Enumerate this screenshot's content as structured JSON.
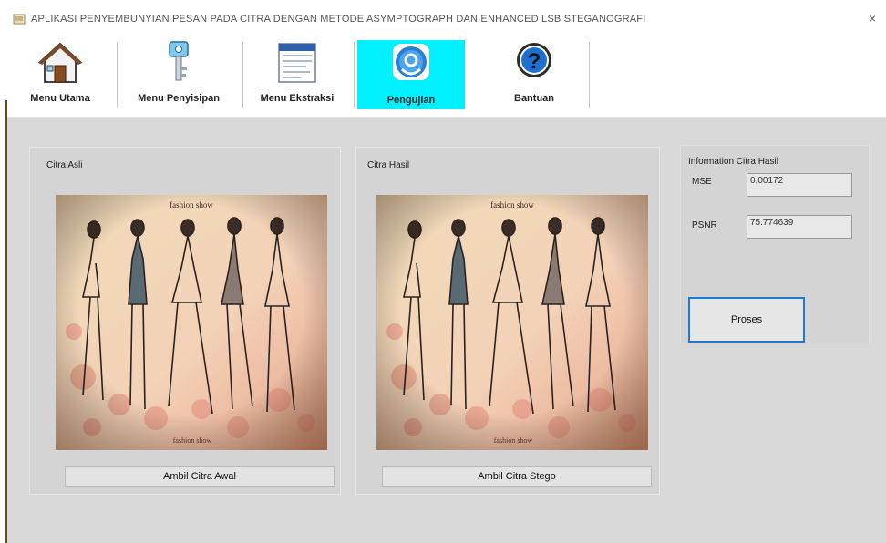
{
  "window": {
    "title": "APLIKASI PENYEMBUNYIAN PESAN PADA CITRA DENGAN METODE ASYMPTOGRAPH DAN ENHANCED LSB STEGANOGRAFI",
    "close_glyph": "×"
  },
  "toolbar": {
    "items": [
      {
        "label": "Menu Utama",
        "icon": "home-icon"
      },
      {
        "label": "Menu Penyisipan",
        "icon": "key-icon"
      },
      {
        "label": "Menu Ekstraksi",
        "icon": "document-icon"
      },
      {
        "label": "Pengujian",
        "icon": "test-icon",
        "active": true
      },
      {
        "label": "Bantuan",
        "icon": "help-icon"
      }
    ],
    "active_color": "#00f0ff"
  },
  "main": {
    "original": {
      "label": "Citra Asli",
      "button": "Ambil Citra Awal"
    },
    "result": {
      "label": "Citra Hasil",
      "button": "Ambil Citra Stego"
    },
    "info": {
      "heading": "Information Citra Hasil",
      "mse_label": "MSE",
      "mse_value": "0.00172",
      "psnr_label": "PSNR",
      "psnr_value": "75.774639",
      "process_button": "Proses"
    }
  }
}
